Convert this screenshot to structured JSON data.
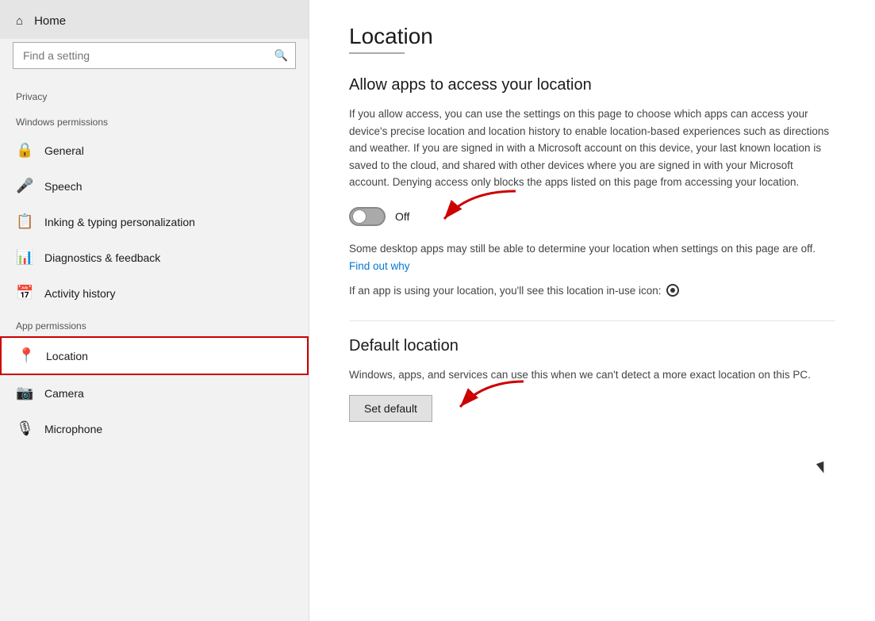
{
  "sidebar": {
    "home_label": "Home",
    "search_placeholder": "Find a setting",
    "privacy_label": "Privacy",
    "windows_permissions_label": "Windows permissions",
    "items_windows": [
      {
        "id": "general",
        "icon": "🔒",
        "label": "General"
      },
      {
        "id": "speech",
        "icon": "🎤",
        "label": "Speech"
      },
      {
        "id": "inking",
        "icon": "📋",
        "label": "Inking & typing personalization"
      },
      {
        "id": "diagnostics",
        "icon": "📊",
        "label": "Diagnostics & feedback"
      },
      {
        "id": "activity",
        "icon": "📅",
        "label": "Activity history"
      }
    ],
    "app_permissions_label": "App permissions",
    "items_app": [
      {
        "id": "location",
        "icon": "📍",
        "label": "Location",
        "active": true
      },
      {
        "id": "camera",
        "icon": "📷",
        "label": "Camera"
      },
      {
        "id": "microphone",
        "icon": "🎙",
        "label": "Microphone"
      }
    ]
  },
  "main": {
    "page_title": "Location",
    "section1_heading": "Allow apps to access your location",
    "section1_description": "If you allow access, you can use the settings on this page to choose which apps can access your device's precise location and location history to enable location-based experiences such as directions and weather. If you are signed in with a Microsoft account on this device, your last known location is saved to the cloud, and shared with other devices where you are signed in with your Microsoft account. Denying access only blocks the apps listed on this page from accessing your location.",
    "toggle_state": "Off",
    "toggle_on": false,
    "desktop_apps_note": "Some desktop apps may still be able to determine your location when settings on this page are off.",
    "find_out_why_label": "Find out why",
    "location_icon_note": "If an app is using your location, you'll see this location in-use icon:",
    "section2_heading": "Default location",
    "default_location_desc": "Windows, apps, and services can use this when we can't detect a more exact location on this PC.",
    "set_default_label": "Set default"
  }
}
